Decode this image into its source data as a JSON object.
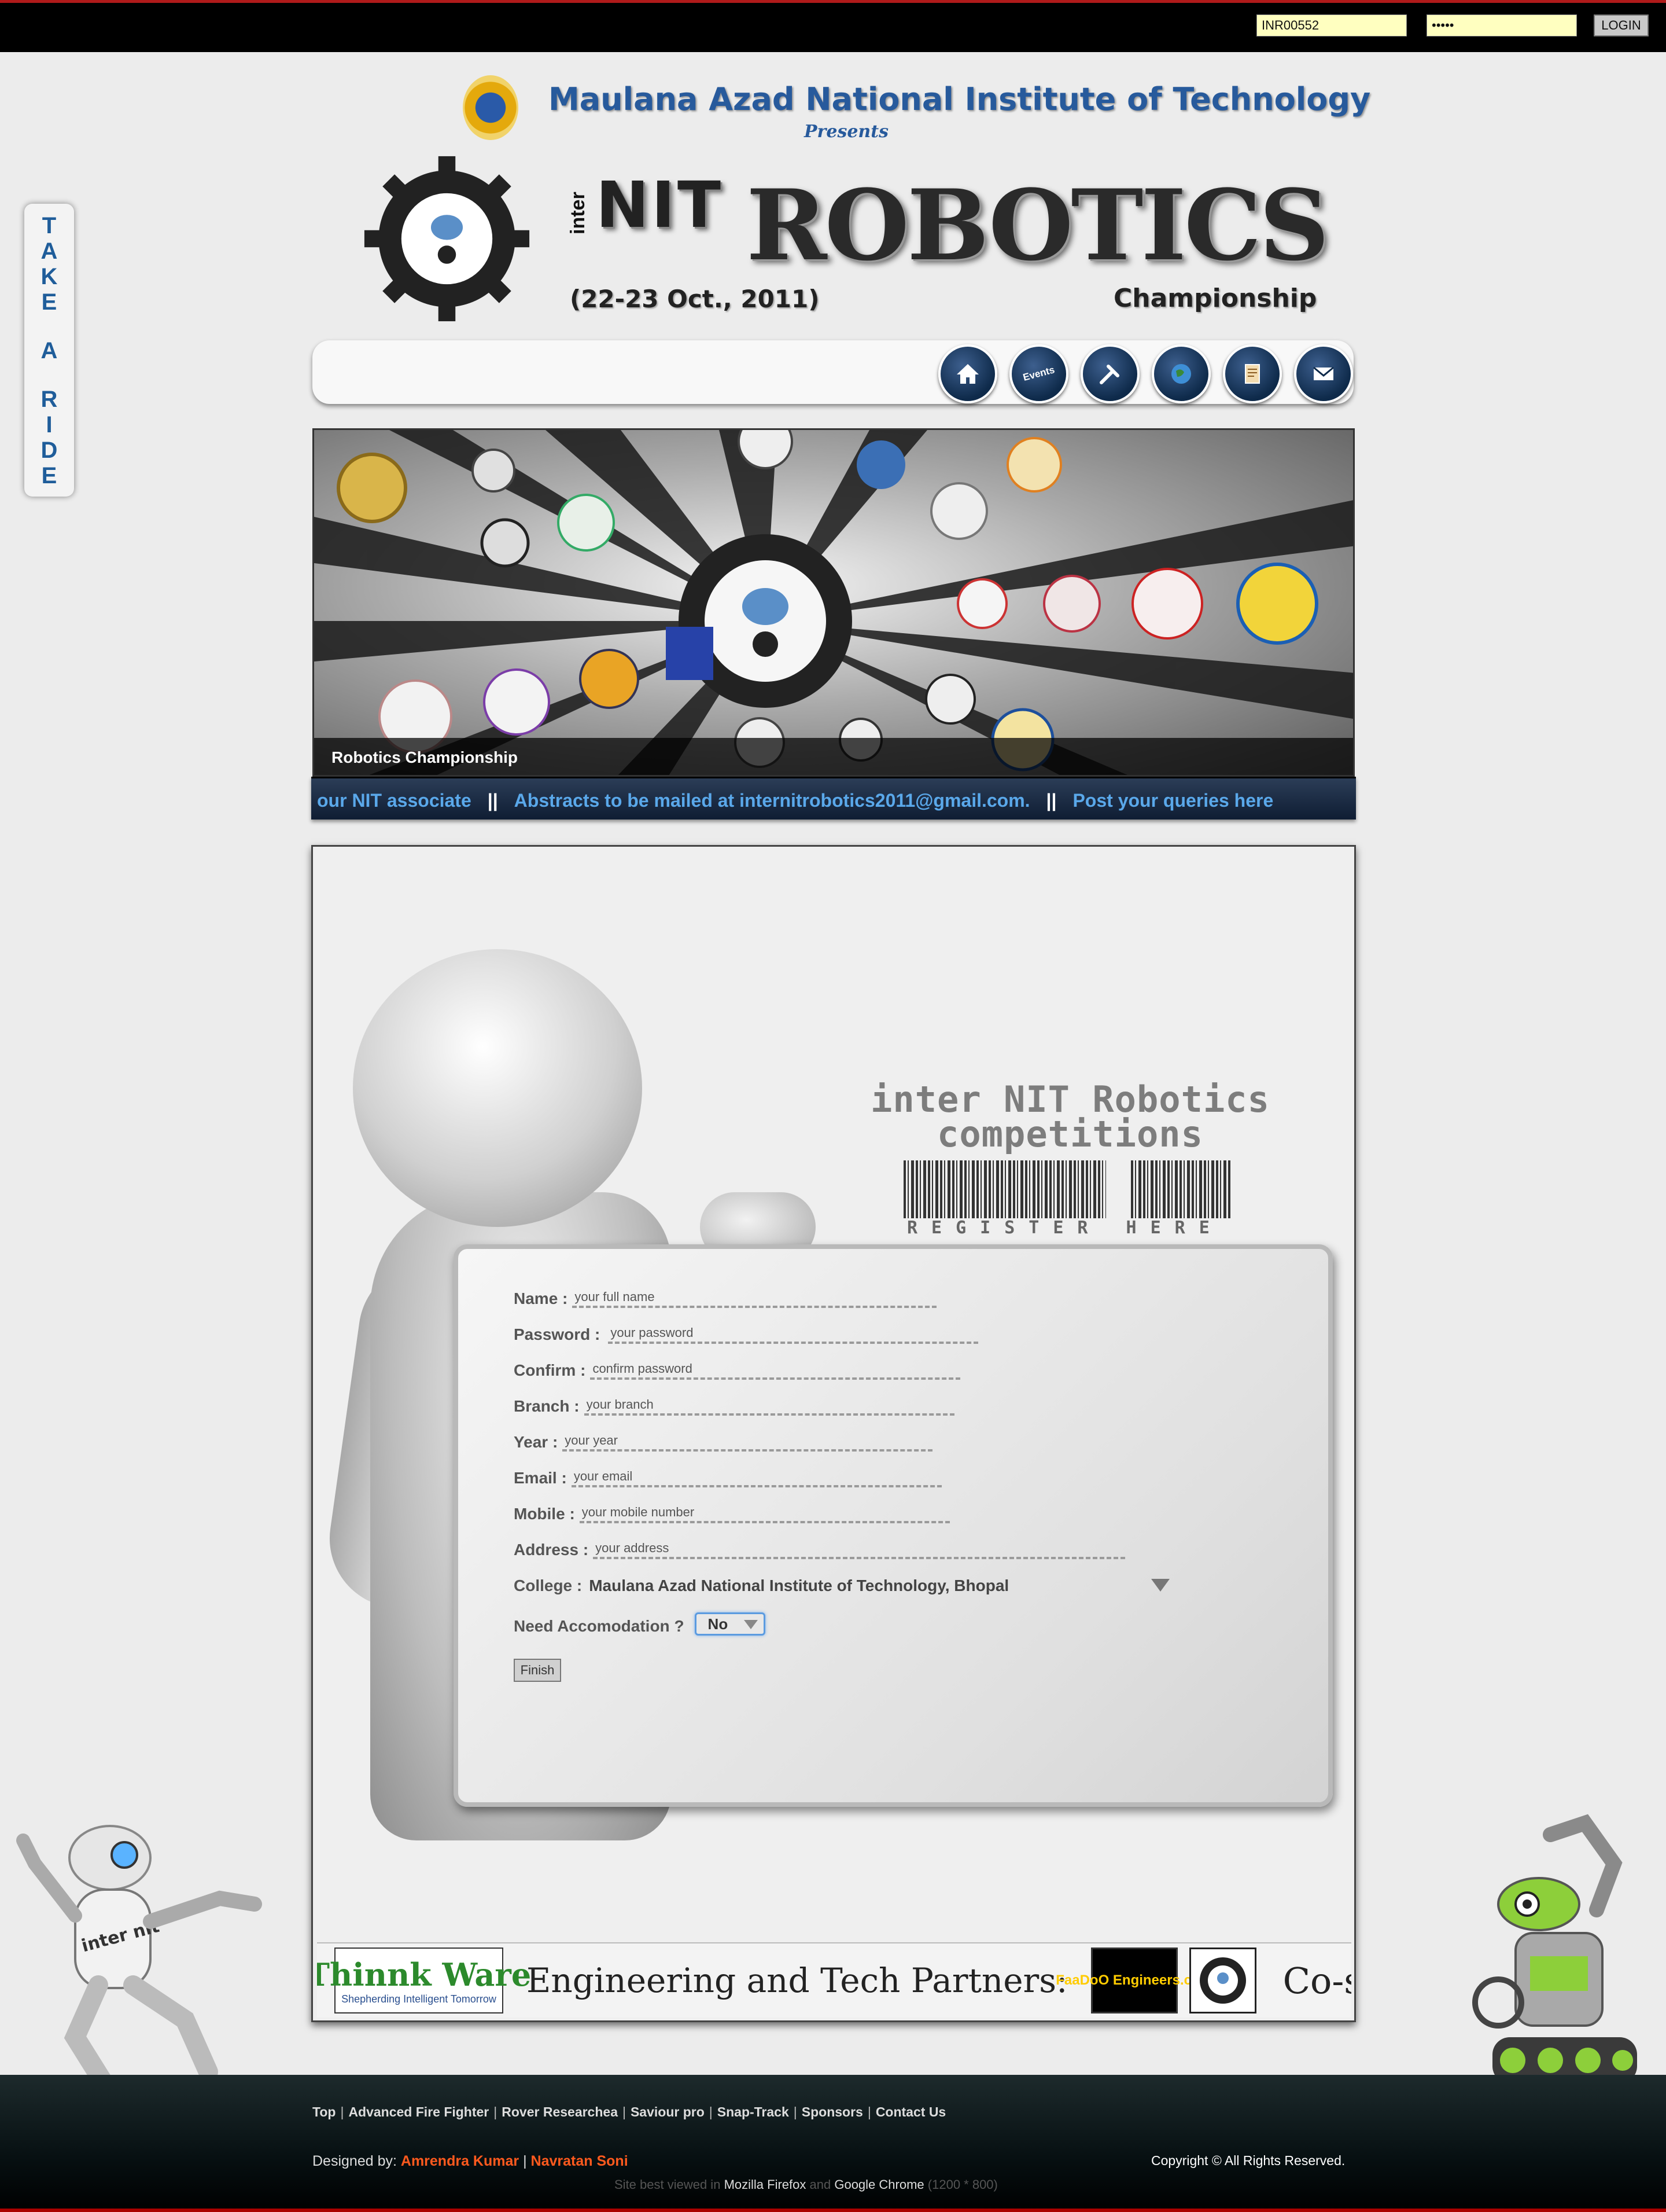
{
  "login": {
    "username_value": "INR00552",
    "password_value": "•••••",
    "login_label": "LOGIN"
  },
  "take_a_ride": [
    "T",
    "A",
    "K",
    "E",
    "",
    "A",
    "",
    "R",
    "I",
    "D",
    "E"
  ],
  "header": {
    "institute": "Maulana Azad National Institute of Technology",
    "presents": "Presents",
    "inter": "inter",
    "nit": "NIT",
    "robotics": "ROBOTICS",
    "dates": "(22-23 Oct., 2011)",
    "championship": "Championship"
  },
  "nav": {
    "icons": [
      "home-icon",
      "events-icon",
      "tools-icon",
      "globe-icon",
      "documents-icon",
      "mail-icon"
    ],
    "events_label": "Events"
  },
  "banner": {
    "caption": "Robotics Championship"
  },
  "ticker": {
    "items": [
      "our NIT associate",
      "Abstracts to be mailed at internitrobotics2011@gmail.com.",
      "Post your queries here"
    ],
    "separator": "||"
  },
  "register": {
    "title_line1": "inter NIT Robotics",
    "title_line2": "competitions",
    "here_text": "REGISTER HERE",
    "fields": [
      {
        "label": "Name :",
        "placeholder": "your full name"
      },
      {
        "label": "Password :",
        "placeholder": "your password"
      },
      {
        "label": "Confirm :",
        "placeholder": "confirm password"
      },
      {
        "label": "Branch :",
        "placeholder": "your branch"
      },
      {
        "label": "Year :",
        "placeholder": "your year"
      },
      {
        "label": "Email :",
        "placeholder": "your email"
      },
      {
        "label": "Mobile :",
        "placeholder": "your mobile number"
      },
      {
        "label": "Address :",
        "placeholder": "your address"
      }
    ],
    "college_label": "College :",
    "college_value": "Maulana Azad National Institute of Technology, Bhopal",
    "accom_label": "Need Accomodation ?",
    "accom_value": "No",
    "finish_label": "Finish"
  },
  "partners": {
    "thinkware_main": "Thinnk Ware",
    "thinkware_sub": "Shepherding Intelligent Tomorrow",
    "label": "Engineering and Tech Partners:",
    "faadoo": "FaaDoO Engineers.com",
    "cospon": "Co-spon"
  },
  "footer": {
    "links": [
      "Top",
      "Advanced Fire Fighter",
      "Rover Researchea",
      "Saviour pro",
      "Snap-Track",
      "Sponsors",
      "Contact Us"
    ],
    "designed_by": "Designed by:",
    "designer1": "Amrendra Kumar",
    "designer_sep": "|",
    "designer2": "Navratan Soni",
    "copyright": "Copyright © All Rights Reserved.",
    "best_viewed_pre": "Site best viewed in",
    "browser1": "Mozilla Firefox",
    "and": "and",
    "browser2": "Google Chrome",
    "resolution": "(1200 * 800)"
  }
}
